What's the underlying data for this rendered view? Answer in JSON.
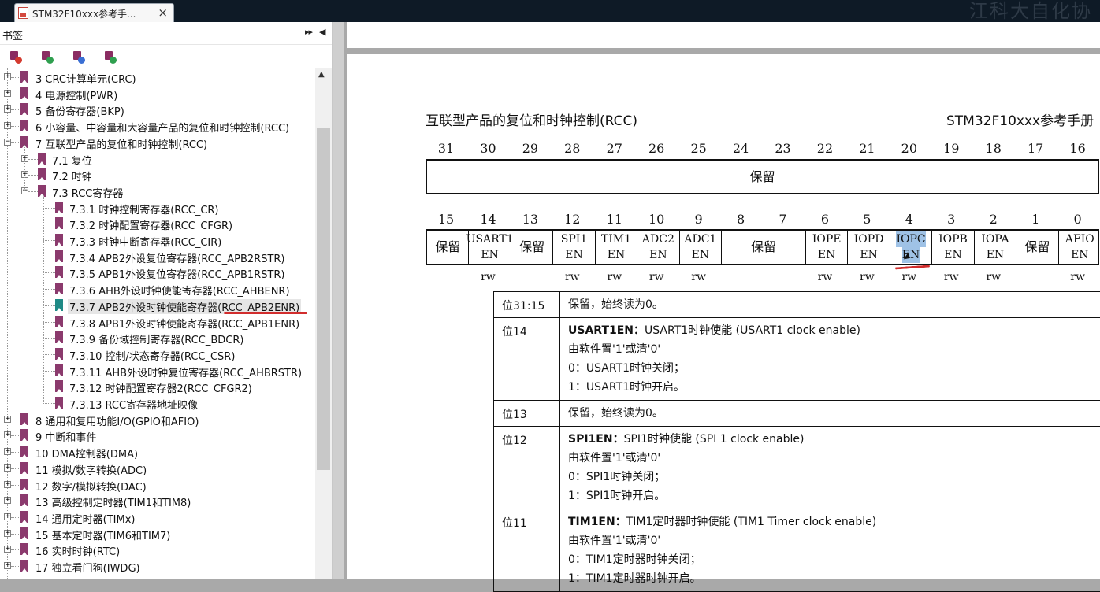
{
  "tab": {
    "title": "STM32F10xxx参考手...",
    "close": "×"
  },
  "watermark": "江科大自化协",
  "panel": {
    "title": "书签",
    "dock_icon": "▸▸",
    "collapse_icon": "◀",
    "toolbar_icons": [
      "delete-bookmark-icon",
      "add-bookmark-icon",
      "goto-bookmark-icon",
      "bookmark-properties-icon"
    ],
    "scroll_up": "▲",
    "items": [
      {
        "label": "3 CRC计算单元(CRC)",
        "level": 0,
        "expander": "+"
      },
      {
        "label": "4 电源控制(PWR)",
        "level": 0,
        "expander": "+"
      },
      {
        "label": "5 备份寄存器(BKP)",
        "level": 0,
        "expander": "+"
      },
      {
        "label": "6 小容量、中容量和大容量产品的复位和时钟控制(RCC)",
        "level": 0,
        "expander": "+"
      },
      {
        "label": "7 互联型产品的复位和时钟控制(RCC)",
        "level": 0,
        "expander": "−"
      },
      {
        "label": "7.1 复位",
        "level": 1,
        "expander": "+"
      },
      {
        "label": "7.2 时钟",
        "level": 1,
        "expander": "+"
      },
      {
        "label": "7.3 RCC寄存器",
        "level": 1,
        "expander": "−"
      },
      {
        "label": "7.3.1 时钟控制寄存器(RCC_CR)",
        "level": 2
      },
      {
        "label": "7.3.2 时钟配置寄存器(RCC_CFGR)",
        "level": 2
      },
      {
        "label": "7.3.3 时钟中断寄存器(RCC_CIR)",
        "level": 2
      },
      {
        "label": "7.3.4 APB2外设复位寄存器(RCC_APB2RSTR)",
        "level": 2
      },
      {
        "label": "7.3.5 APB1外设复位寄存器(RCC_APB1RSTR)",
        "level": 2
      },
      {
        "label": "7.3.6 AHB外设时钟使能寄存器(RCC_AHBENR)",
        "level": 2
      },
      {
        "label": "7.3.7 APB2外设时钟使能寄存器(RCC_APB2ENR)",
        "level": 2,
        "selected": true
      },
      {
        "label": "7.3.8 APB1外设时钟使能寄存器(RCC_APB1ENR)",
        "level": 2
      },
      {
        "label": "7.3.9 备份域控制寄存器(RCC_BDCR)",
        "level": 2
      },
      {
        "label": "7.3.10 控制/状态寄存器(RCC_CSR)",
        "level": 2
      },
      {
        "label": "7.3.11 AHB外设时钟复位寄存器(RCC_AHBRSTR)",
        "level": 2
      },
      {
        "label": "7.3.12 时钟配置寄存器2(RCC_CFGR2)",
        "level": 2
      },
      {
        "label": "7.3.13 RCC寄存器地址映像",
        "level": 2
      },
      {
        "label": "8 通用和复用功能I/O(GPIO和AFIO)",
        "level": 0,
        "expander": "+"
      },
      {
        "label": "9 中断和事件",
        "level": 0,
        "expander": "+"
      },
      {
        "label": "10 DMA控制器(DMA)",
        "level": 0,
        "expander": "+"
      },
      {
        "label": "11 模拟/数字转换(ADC)",
        "level": 0,
        "expander": "+"
      },
      {
        "label": "12 数字/模拟转换(DAC)",
        "level": 0,
        "expander": "+"
      },
      {
        "label": "13 高级控制定时器(TIM1和TIM8)",
        "level": 0,
        "expander": "+"
      },
      {
        "label": "14 通用定时器(TIMx)",
        "level": 0,
        "expander": "+"
      },
      {
        "label": "15 基本定时器(TIM6和TIM7)",
        "level": 0,
        "expander": "+"
      },
      {
        "label": "16 实时时钟(RTC)",
        "level": 0,
        "expander": "+"
      },
      {
        "label": "17 独立看门狗(IWDG)",
        "level": 0,
        "expander": "+"
      }
    ]
  },
  "document": {
    "header_left": "互联型产品的复位和时钟控制(RCC)",
    "header_right": "STM32F10xxx参考手册",
    "high_bits": [
      "31",
      "30",
      "29",
      "28",
      "27",
      "26",
      "25",
      "24",
      "23",
      "22",
      "21",
      "20",
      "19",
      "18",
      "17",
      "16"
    ],
    "high_reserved": "保留",
    "low_bits": [
      "15",
      "14",
      "13",
      "12",
      "11",
      "10",
      "9",
      "8",
      "7",
      "6",
      "5",
      "4",
      "3",
      "2",
      "1",
      "0"
    ],
    "low_fields": [
      {
        "name": "保留",
        "span": 1,
        "access": ""
      },
      {
        "name": "USART1",
        "sub": "EN",
        "span": 1,
        "access": "rw"
      },
      {
        "name": "保留",
        "span": 1,
        "access": ""
      },
      {
        "name": "SPI1",
        "sub": "EN",
        "span": 1,
        "access": "rw"
      },
      {
        "name": "TIM1",
        "sub": "EN",
        "span": 1,
        "access": "rw"
      },
      {
        "name": "ADC2",
        "sub": "EN",
        "span": 1,
        "access": "rw"
      },
      {
        "name": "ADC1",
        "sub": "EN",
        "span": 1,
        "access": "rw"
      },
      {
        "name": "保留",
        "span": 2,
        "access": ""
      },
      {
        "name": "IOPE",
        "sub": "EN",
        "span": 1,
        "access": "rw"
      },
      {
        "name": "IOPD",
        "sub": "EN",
        "span": 1,
        "access": "rw"
      },
      {
        "name": "IOPC",
        "sub": "EN",
        "span": 1,
        "access": "rw",
        "highlight": true
      },
      {
        "name": "IOPB",
        "sub": "EN",
        "span": 1,
        "access": "rw"
      },
      {
        "name": "IOPA",
        "sub": "EN",
        "span": 1,
        "access": "rw"
      },
      {
        "name": "保留",
        "span": 1,
        "access": ""
      },
      {
        "name": "AFIO",
        "sub": "EN",
        "span": 1,
        "access": "rw"
      }
    ],
    "descriptions": [
      {
        "bit": "位31:15",
        "lines": [
          {
            "t": "保留，始终读为0。"
          }
        ]
      },
      {
        "bit": "位14",
        "lines": [
          {
            "t": "USART1EN：",
            "bold": true,
            "rest": "USART1时钟使能 (USART1 clock enable)"
          },
          {
            "t": "由软件置'1'或清'0'"
          },
          {
            "t": "0：USART1时钟关闭；"
          },
          {
            "t": "1：USART1时钟开启。"
          }
        ]
      },
      {
        "bit": "位13",
        "lines": [
          {
            "t": "保留，始终读为0。"
          }
        ]
      },
      {
        "bit": "位12",
        "lines": [
          {
            "t": "SPI1EN：",
            "bold": true,
            "rest": "SPI1时钟使能 (SPI 1 clock enable)"
          },
          {
            "t": "由软件置'1'或清'0'"
          },
          {
            "t": "0：SPI1时钟关闭；"
          },
          {
            "t": "1：SPI1时钟开启。"
          }
        ]
      },
      {
        "bit": "位11",
        "lines": [
          {
            "t": "TIM1EN：",
            "bold": true,
            "rest": "TIM1定时器时钟使能 (TIM1 Timer clock enable)"
          },
          {
            "t": "由软件置'1'或清'0'"
          },
          {
            "t": "0：TIM1定时器时钟关闭；"
          },
          {
            "t": "1：TIM1定时器时钟开启。"
          }
        ]
      }
    ]
  }
}
